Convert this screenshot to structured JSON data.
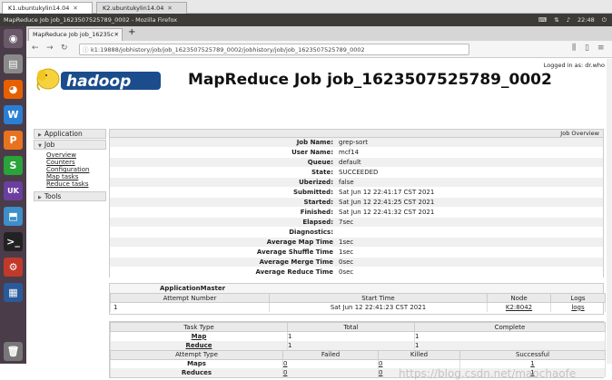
{
  "vm_tabs": [
    {
      "label": "K1.ubuntukylin14.04"
    },
    {
      "label": "K2.ubuntukylin14.04"
    }
  ],
  "window": {
    "title": "MapReduce Job job_1623507525789_0002 - Mozilla Firefox",
    "clock": "22:48"
  },
  "browser": {
    "tab_label": "MapReduce Job job_16235c",
    "url": "k1:19888/jobhistory/job/job_1623507525789_0002/jobhistory/job/job_1623507525789_0002"
  },
  "page": {
    "logged_in": "Logged in as: dr.who",
    "logo_text": "hadoop",
    "title": "MapReduce Job job_1623507525789_0002"
  },
  "sidenav": {
    "application": "Application",
    "job": "Job",
    "links": [
      "Overview",
      "Counters",
      "Configuration",
      "Map tasks",
      "Reduce tasks"
    ],
    "tools": "Tools"
  },
  "overview": {
    "header": "Job Overview",
    "rows": [
      {
        "k": "Job Name:",
        "v": "grep-sort"
      },
      {
        "k": "User Name:",
        "v": "mcf14"
      },
      {
        "k": "Queue:",
        "v": "default"
      },
      {
        "k": "State:",
        "v": "SUCCEEDED"
      },
      {
        "k": "Uberized:",
        "v": "false"
      },
      {
        "k": "Submitted:",
        "v": "Sat Jun 12 22:41:17 CST 2021"
      },
      {
        "k": "Started:",
        "v": "Sat Jun 12 22:41:25 CST 2021"
      },
      {
        "k": "Finished:",
        "v": "Sat Jun 12 22:41:32 CST 2021"
      },
      {
        "k": "Elapsed:",
        "v": "7sec"
      },
      {
        "k": "Diagnostics:",
        "v": ""
      },
      {
        "k": "Average Map Time",
        "v": "1sec"
      },
      {
        "k": "Average Shuffle Time",
        "v": "1sec"
      },
      {
        "k": "Average Merge Time",
        "v": "0sec"
      },
      {
        "k": "Average Reduce Time",
        "v": "0sec"
      }
    ]
  },
  "am": {
    "title": "ApplicationMaster",
    "headers": [
      "Attempt Number",
      "Start Time",
      "Node",
      "Logs"
    ],
    "row": {
      "attempt": "1",
      "start": "Sat Jun 12 22:41:23 CST 2021",
      "node": "K2:8042",
      "logs": "logs"
    }
  },
  "tasks": {
    "headers": [
      "Task Type",
      "Total",
      "Complete"
    ],
    "rows": [
      {
        "type": "Map",
        "total": "1",
        "complete": "1"
      },
      {
        "type": "Reduce",
        "total": "1",
        "complete": "1"
      }
    ],
    "attempt_headers": [
      "Attempt Type",
      "Failed",
      "Killed",
      "Successful"
    ],
    "attempt_rows": [
      {
        "type": "Maps",
        "failed": "0",
        "killed": "0",
        "successful": "1"
      },
      {
        "type": "Reduces",
        "failed": "0",
        "killed": "0",
        "successful": "1"
      }
    ]
  },
  "watermark": "https://blog.csdn.net/maochaofe"
}
